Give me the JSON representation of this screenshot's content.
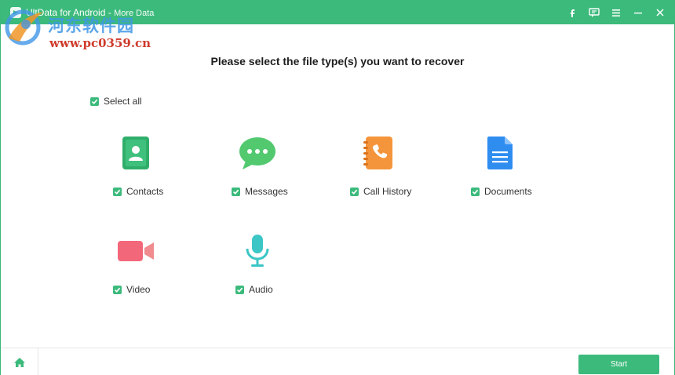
{
  "titlebar": {
    "app_name": "UltData for Android",
    "separator": " - ",
    "mode": "More Data",
    "buttons": [
      "facebook-icon",
      "feedback-icon",
      "menu-icon",
      "minimize-icon",
      "close-icon"
    ]
  },
  "watermark": {
    "name": "河东软件园",
    "url": "www.pc0359.cn"
  },
  "main": {
    "heading": "Please select the file type(s) you want to recover",
    "select_all_label": "Select all",
    "select_all_checked": true,
    "file_types": [
      {
        "label": "Contacts",
        "icon": "contacts-icon",
        "checked": true,
        "color": "#2fae6a"
      },
      {
        "label": "Messages",
        "icon": "messages-icon",
        "checked": true,
        "color": "#52c96f"
      },
      {
        "label": "Call History",
        "icon": "call-history-icon",
        "checked": true,
        "color": "#f5953b"
      },
      {
        "label": "Documents",
        "icon": "documents-icon",
        "checked": true,
        "color": "#2f8df0"
      },
      {
        "label": "Video",
        "icon": "video-icon",
        "checked": true,
        "color": "#f3677a"
      },
      {
        "label": "Audio",
        "icon": "audio-icon",
        "checked": true,
        "color": "#3cc6c6"
      }
    ]
  },
  "footer": {
    "home_icon": "home-icon",
    "start_label": "Start"
  },
  "colors": {
    "accent": "#3cba7c",
    "watermark_blue": "#4096e6",
    "watermark_red": "#cf3a2b"
  }
}
